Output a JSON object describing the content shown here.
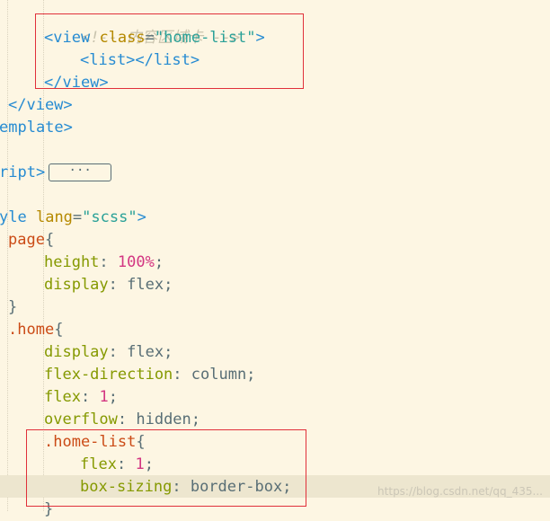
{
  "code": {
    "l1_comment": "<!-- 内容区域卡 -->",
    "l2_open": "<",
    "l2_tag": "view",
    "l2_attr": "class",
    "l2_eq": "=",
    "l2_val": "\"home-list\"",
    "l2_close": ">",
    "l3_tag": "<list></list>",
    "l4_tag": "</view>",
    "l5_tag": "</view>",
    "l6_tag": "emplate>",
    "l7_tag": "ript>",
    "l7_fold": "···",
    "l8_tag": "yle",
    "l8_attr": "lang",
    "l8_eq": "=",
    "l8_val": "\"scss\"",
    "l8_close": ">",
    "l9_sel": "page",
    "l9_brace": "{",
    "l10_prop": "height",
    "l10_colon": ": ",
    "l10_num": "100%",
    "l10_semi": ";",
    "l11_prop": "display",
    "l11_rest": ": flex;",
    "l12_brace": "}",
    "l13_sel": ".home",
    "l13_brace": "{",
    "l14_prop": "display",
    "l14_rest": ": flex;",
    "l15_prop": "flex-direction",
    "l15_rest": ": column;",
    "l16_prop": "flex",
    "l16_colon": ": ",
    "l16_num": "1",
    "l16_semi": ";",
    "l17_prop": "overflow",
    "l17_rest": ": hidden;",
    "l18_sel": ".home-list",
    "l18_brace": "{",
    "l19_prop": "flex",
    "l19_colon": ": ",
    "l19_num": "1",
    "l19_semi": ";",
    "l20_prop": "box-sizing",
    "l20_rest": ": border-box;",
    "l21_brace": "}"
  },
  "watermark": "https://blog.csdn.net/qq_435..."
}
